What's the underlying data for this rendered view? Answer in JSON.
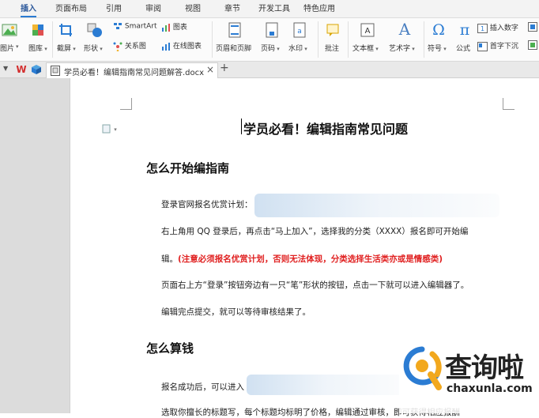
{
  "ribbon": {
    "tabs": [
      "插入",
      "页面布局",
      "引用",
      "审阅",
      "视图",
      "章节",
      "开发工具",
      "特色应用"
    ],
    "active_tab": "插入"
  },
  "toolbar": {
    "picture": "图片",
    "gallery": "图库",
    "screenshot": "截屏",
    "shape": "形状",
    "smartart": "SmartArt",
    "chart": "图表",
    "relation": "关系图",
    "online_chart": "在线图表",
    "header_footer": "页眉和页脚",
    "page_number": "页码",
    "watermark": "水印",
    "comment": "批注",
    "textbox": "文本框",
    "wordart": "艺术字",
    "symbol": "符号",
    "formula": "公式",
    "insert_number": "插入数字",
    "drop_cap": "首字下沉"
  },
  "document_tab": {
    "title": "学员必看！编辑指南常见问题解答.docx",
    "add_symbol": "+",
    "close_symbol": "×"
  },
  "document": {
    "title": "学员必看！编辑指南常见问题",
    "section1_heading": "怎么开始编指南",
    "p1": "登录官网报名优赏计划：",
    "p2": "右上角用 QQ 登录后，再点击“马上加入”，选择我的分类（XXXX）报名即可开始编",
    "p3_prefix": "辑。",
    "p3_red": "(注意必须报名优赏计划，否则无法体现，分类选择生活类亦或是情感类)",
    "p4": "页面右上方“登录”按钮旁边有一只“笔”形状的按钮，点击一下就可以进入编辑器了。",
    "p5": "编辑完点提交，就可以等待审核结果了。",
    "section2_heading": "怎么算钱",
    "p6": "报名成功后，可以进入",
    "p7": "选取你擅长的标题写，每个标题均标明了价格，编辑通过审核，即可获得相应报酬"
  },
  "watermark": {
    "brand_cn": "查询啦",
    "brand_url": "chaxunla.com"
  },
  "colors": {
    "accent": "#2b7cd3",
    "red_note": "#e02020",
    "wps_red": "#d32f2f"
  }
}
